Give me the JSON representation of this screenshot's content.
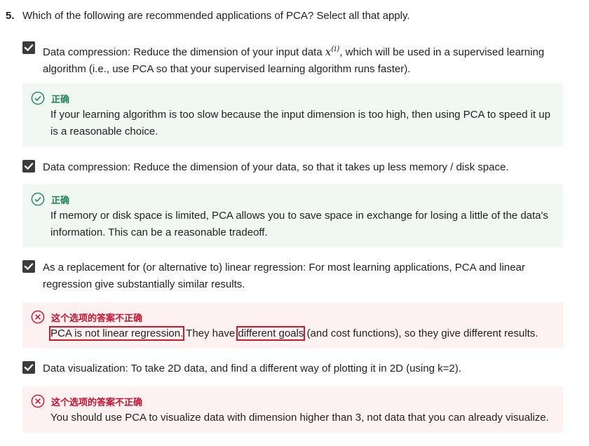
{
  "question": {
    "number": "5.",
    "text": "Which of the following are recommended applications of PCA? Select all that apply."
  },
  "options": [
    {
      "checked": true,
      "text_before": "Data compression: Reduce the dimension of your input data ",
      "math_var": "x",
      "math_sup": "(i)",
      "text_after": ", which will be used in a supervised learning algorithm (i.e., use PCA so that your supervised learning algorithm runs faster).",
      "feedback": {
        "status": "correct",
        "label": "正确",
        "text": "If your learning algorithm is too slow because the input dimension is too high, then using PCA to speed it up is a reasonable choice."
      }
    },
    {
      "checked": true,
      "text": "Data compression: Reduce the dimension of your data, so that it takes up less memory / disk space.",
      "feedback": {
        "status": "correct",
        "label": "正确",
        "text": "If memory or disk space is limited, PCA allows you to save space in exchange for losing a little of the data's information. This can be a reasonable tradeoff."
      }
    },
    {
      "checked": true,
      "text": "As a replacement for (or alternative to) linear regression: For most learning applications, PCA and linear regression give substantially similar results.",
      "feedback": {
        "status": "incorrect",
        "label": "这个选项的答案不正确",
        "text_part1": "PCA is not linear regression.",
        "text_part2": " They have ",
        "text_part3": "different goals",
        "text_part4": " (and cost functions), so they give different results."
      }
    },
    {
      "checked": true,
      "text": "Data visualization: To take 2D data, and find a different way of plotting it in 2D (using k=2).",
      "feedback": {
        "status": "incorrect",
        "label": "这个选项的答案不正确",
        "text": "You should use PCA to visualize data with dimension higher than 3, not data that you can already visualize."
      }
    }
  ],
  "colors": {
    "correct": "#1f8354",
    "incorrect": "#c8102e",
    "correct_bg": "#f1f8f3",
    "incorrect_bg": "#fdf1f1",
    "checkbox": "#3c3c3c",
    "highlight_box": "#d4172b"
  }
}
